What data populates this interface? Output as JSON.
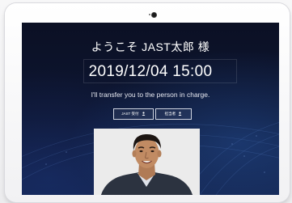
{
  "welcome_text": "ようこそ JAST太郎 様",
  "datetime": "2019/12/04 15:00",
  "message": "I'll transfer you to the person in charge.",
  "buttons": [
    {
      "label": "JAST 受付"
    },
    {
      "label": "担当者"
    }
  ],
  "colors": {
    "screen_background": "#0e1632",
    "text": "#ffffff",
    "photo_background": "#ebebeb"
  }
}
